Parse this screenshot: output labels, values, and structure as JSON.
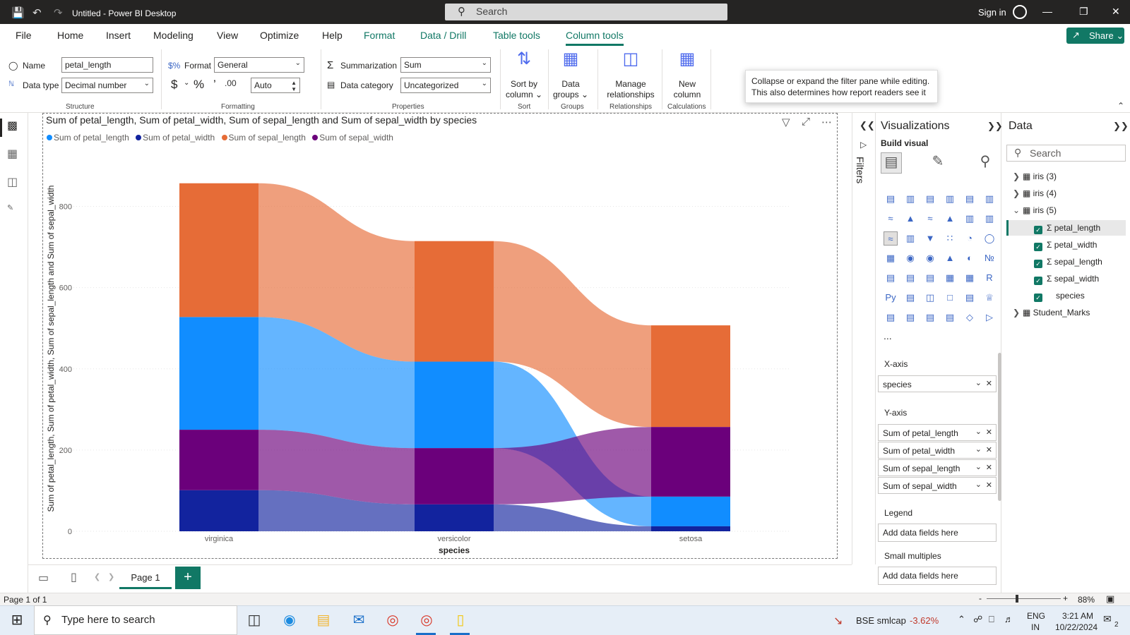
{
  "titlebar": {
    "title": "Untitled - Power BI Desktop",
    "search_placeholder": "Search",
    "sign_in": "Sign in",
    "icons": [
      "save-icon",
      "undo-icon",
      "redo-icon",
      "minimize-icon",
      "restore-icon",
      "close-icon"
    ]
  },
  "menu": {
    "items": [
      "File",
      "Home",
      "Insert",
      "Modeling",
      "View",
      "Optimize",
      "Help",
      "Format",
      "Data / Drill",
      "Table tools",
      "Column tools"
    ],
    "share": "Share"
  },
  "ribbon": {
    "name_label": "Name",
    "name_value": "petal_length",
    "datatype_label": "Data type",
    "datatype_value": "Decimal number",
    "structure": "Structure",
    "format_label": "Format",
    "format_value": "General",
    "decimals_value": "Auto",
    "formatting": "Formatting",
    "summarization_label": "Summarization",
    "summarization_value": "Sum",
    "datacategory_label": "Data category",
    "datacategory_value": "Uncategorized",
    "properties": "Properties",
    "sort_by_column": "Sort by column",
    "sort": "Sort",
    "data_groups": "Data groups",
    "groups": "Groups",
    "manage_relationships": "Manage relationships",
    "relationships": "Relationships",
    "new_column": "New column",
    "calculations": "Calculations",
    "tooltip": "Collapse or expand the filter pane while editing. This also determines how report readers see it"
  },
  "visual": {
    "title": "Sum of petal_length, Sum of petal_width, Sum of sepal_length and Sum of sepal_width by species",
    "legend": [
      "Sum of petal_length",
      "Sum of petal_width",
      "Sum of sepal_length",
      "Sum of sepal_width"
    ]
  },
  "chart_data": {
    "type": "area",
    "subtype": "ribbon",
    "categories": [
      "virginica",
      "versicolor",
      "setosa"
    ],
    "xlabel": "species",
    "ylabel": "Sum of petal_length, Sum of petal_width, Sum of sepal_length and Sum of sepal_width",
    "ylim": [
      0,
      900
    ],
    "yticks": [
      0,
      200,
      400,
      600,
      800
    ],
    "legend_position": "top-left",
    "grid": true,
    "series": [
      {
        "name": "Sum of petal_length",
        "values": [
          277.6,
          213.0,
          73.1
        ],
        "color": "#118DFF"
      },
      {
        "name": "Sum of petal_width",
        "values": [
          101.3,
          66.3,
          12.3
        ],
        "color": "#12239E"
      },
      {
        "name": "Sum of sepal_length",
        "values": [
          329.4,
          296.8,
          250.3
        ],
        "color": "#E66C37"
      },
      {
        "name": "Sum of sepal_width",
        "values": [
          148.7,
          138.5,
          171.4
        ],
        "color": "#6B007B"
      }
    ]
  },
  "filters": {
    "label": "Filters"
  },
  "viz_pane": {
    "title": "Visualizations",
    "build_visual": "Build visual",
    "xaxis_label": "X-axis",
    "xaxis_field": "species",
    "yaxis_label": "Y-axis",
    "yaxis_fields": [
      "Sum of petal_length",
      "Sum of petal_width",
      "Sum of sepal_length",
      "Sum of sepal_width"
    ],
    "legend_label": "Legend",
    "legend_placeholder": "Add data fields here",
    "small_multiples_label": "Small multiples",
    "small_multiples_placeholder": "Add data fields here",
    "more": "..."
  },
  "data_pane": {
    "title": "Data",
    "search_placeholder": "Search",
    "tables": [
      "iris (3)",
      "iris (4)",
      "iris (5)",
      "Student_Marks"
    ],
    "fields": [
      "petal_length",
      "petal_width",
      "sepal_length",
      "sepal_width",
      "species"
    ]
  },
  "pages": {
    "tab": "Page 1",
    "status": "Page 1 of 1",
    "zoom": "88%"
  },
  "taskbar": {
    "search": "Type here to search",
    "stock_name": "BSE smlcap",
    "stock_change": "-3.62%",
    "lang1": "ENG",
    "lang2": "IN",
    "time": "3:21 AM",
    "date": "10/22/2024",
    "notif": "2"
  }
}
